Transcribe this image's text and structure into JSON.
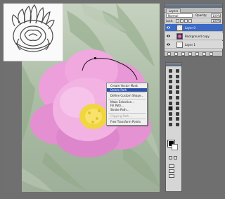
{
  "layers_panel": {
    "tab_label": "Layers",
    "blend_mode": "Normal",
    "opacity_label": "Opacity:",
    "opacity_value": "100%",
    "lock_label": "Lock:",
    "fill_value": "100%",
    "layers": [
      {
        "name": "Layer 0",
        "selected": true
      },
      {
        "name": "Background copy",
        "selected": false
      },
      {
        "name": "Layer 1",
        "selected": false
      }
    ]
  },
  "context_menu": {
    "items": [
      {
        "label": "Create Vector Mask",
        "state": "normal"
      },
      {
        "label": "Delete Path",
        "state": "selected"
      },
      {
        "label": "Define Custom Shape...",
        "state": "normal"
      },
      {
        "label": "Make Selection...",
        "state": "normal"
      },
      {
        "label": "Fill Path...",
        "state": "normal"
      },
      {
        "label": "Stroke Path...",
        "state": "normal"
      },
      {
        "label": "Clipping Path...",
        "state": "disabled"
      },
      {
        "label": "Free Transform Points",
        "state": "normal"
      }
    ]
  },
  "colors": {
    "menu_highlight": "#2f53a9",
    "layer_selected": "#3c6bc6",
    "flower_pink": "#e89ad8",
    "foreground": "#000000",
    "background": "#ffffff"
  },
  "icons": [
    "eye-icon",
    "lock-icon",
    "tool-icons",
    "foreground-color-swatch",
    "background-color-swatch"
  ]
}
